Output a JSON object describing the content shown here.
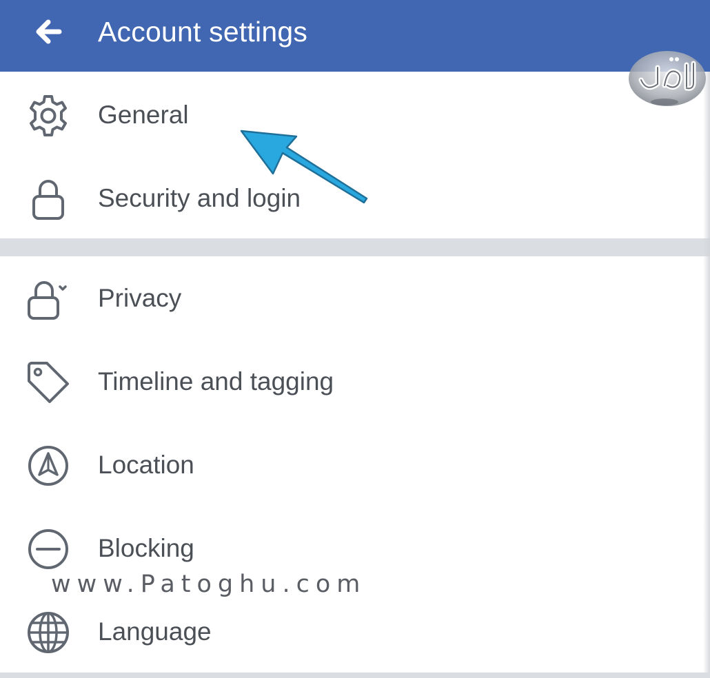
{
  "header": {
    "title": "Account settings",
    "back_icon": "arrow-left-icon",
    "color": "#4267b2"
  },
  "sections": [
    {
      "items": [
        {
          "label": "General",
          "icon": "gear-icon"
        },
        {
          "label": "Security and login",
          "icon": "lock-icon"
        }
      ]
    },
    {
      "items": [
        {
          "label": "Privacy",
          "icon": "lock-chevron-icon"
        },
        {
          "label": "Timeline and tagging",
          "icon": "tag-icon"
        },
        {
          "label": "Location",
          "icon": "location-arrow-icon"
        },
        {
          "label": "Blocking",
          "icon": "block-icon"
        },
        {
          "label": "Language",
          "icon": "globe-icon"
        }
      ]
    }
  ],
  "watermark": {
    "text": "www.Patoghu.com",
    "color": "#5a5d63"
  },
  "colors": {
    "separator": "#dadde1",
    "item_text": "#4b4f56",
    "icon_stroke": "#606770",
    "annotation_arrow": "#29a8e0"
  }
}
